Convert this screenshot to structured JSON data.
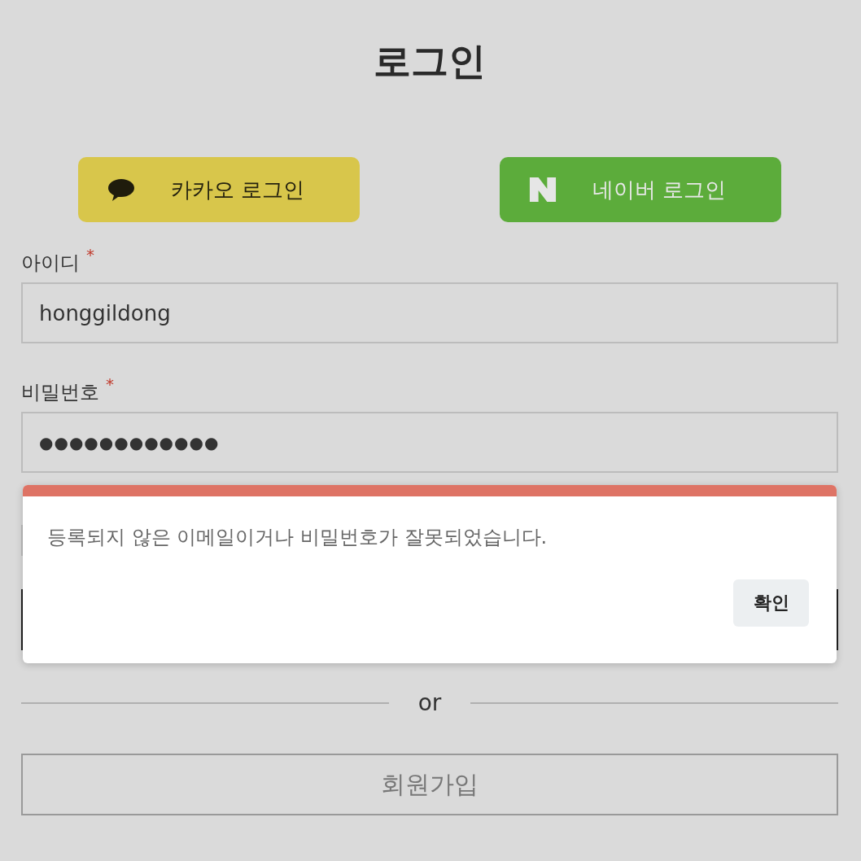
{
  "title": "로그인",
  "social_buttons": [
    {
      "kind": "kakao",
      "label": "카카오 로그인"
    },
    {
      "kind": "naver",
      "label": "네이버 로그인"
    }
  ],
  "fields": [
    {
      "label": "아이디",
      "required": "*",
      "value": "honggildong"
    },
    {
      "label": "비밀번호",
      "required": "*",
      "value": "●●●●●●●●●●●●"
    }
  ],
  "divider_text": "or",
  "signup_button": "회원가입",
  "alert": {
    "message": "등록되지 않은 이메일이거나 비밀번호가 잘못되었습니다.",
    "confirm_button": "확인"
  }
}
